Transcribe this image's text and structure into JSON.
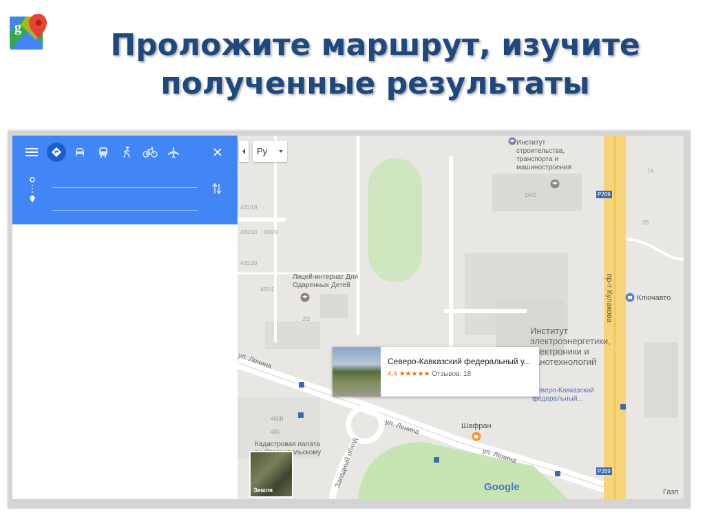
{
  "slide": {
    "title_line1": "Проложите маршрут, изучите",
    "title_line2": "полученные результаты"
  },
  "directions": {
    "modes": [
      "menu-icon",
      "directions-icon",
      "car-icon",
      "transit-icon",
      "walk-icon",
      "bike-icon",
      "flight-icon"
    ],
    "origin_value": "",
    "destination_value": ""
  },
  "map": {
    "language_select": "Ру",
    "labels": {
      "institute_construction": [
        "Институт",
        "строительства,",
        "транспорта и",
        "машиностроения"
      ],
      "lyceum": [
        "Лицей-интернат Для",
        "Одаренных Детей"
      ],
      "energy_institute": [
        "Институт",
        "электроэнергетики,",
        "электроники и",
        "нанотехнологий"
      ],
      "kluchavto": "Ключавто",
      "street_kulakova": "пр-т Кулакова",
      "street_lenina_1": "ул. Ленина",
      "street_lenina_2": "ул. Ленина",
      "street_lenina_3": "ул. Ленина",
      "western_bypass": "Западный обход",
      "cadastral": [
        "Кадастровая палата",
        "по Ставропольскому"
      ],
      "shafran": "Шафран",
      "skfu_small": [
        "Северо-Кавказский",
        "федеральный..."
      ],
      "gazprom": "Газп",
      "road_badge_1": "P269",
      "road_badge_2": "P269",
      "google": "Google",
      "earth_label": "Земля"
    },
    "house_numbers": [
      "431/18",
      "431/10",
      "434/9",
      "431/20",
      "431/1",
      "2/2",
      "2А/2",
      "7А",
      "3Б",
      "480В",
      "480"
    ],
    "place_card": {
      "name": "Северо-Кавказский федеральный у...",
      "rating": "4,4",
      "stars": "★★★★★",
      "reviews": "Отзывов: 18"
    }
  },
  "colors": {
    "title": "#1f497d",
    "panel_blue": "#4285f4",
    "road_yellow": "#f6d57a",
    "park_green": "#c7e5b2",
    "rating_orange": "#e7711b"
  }
}
